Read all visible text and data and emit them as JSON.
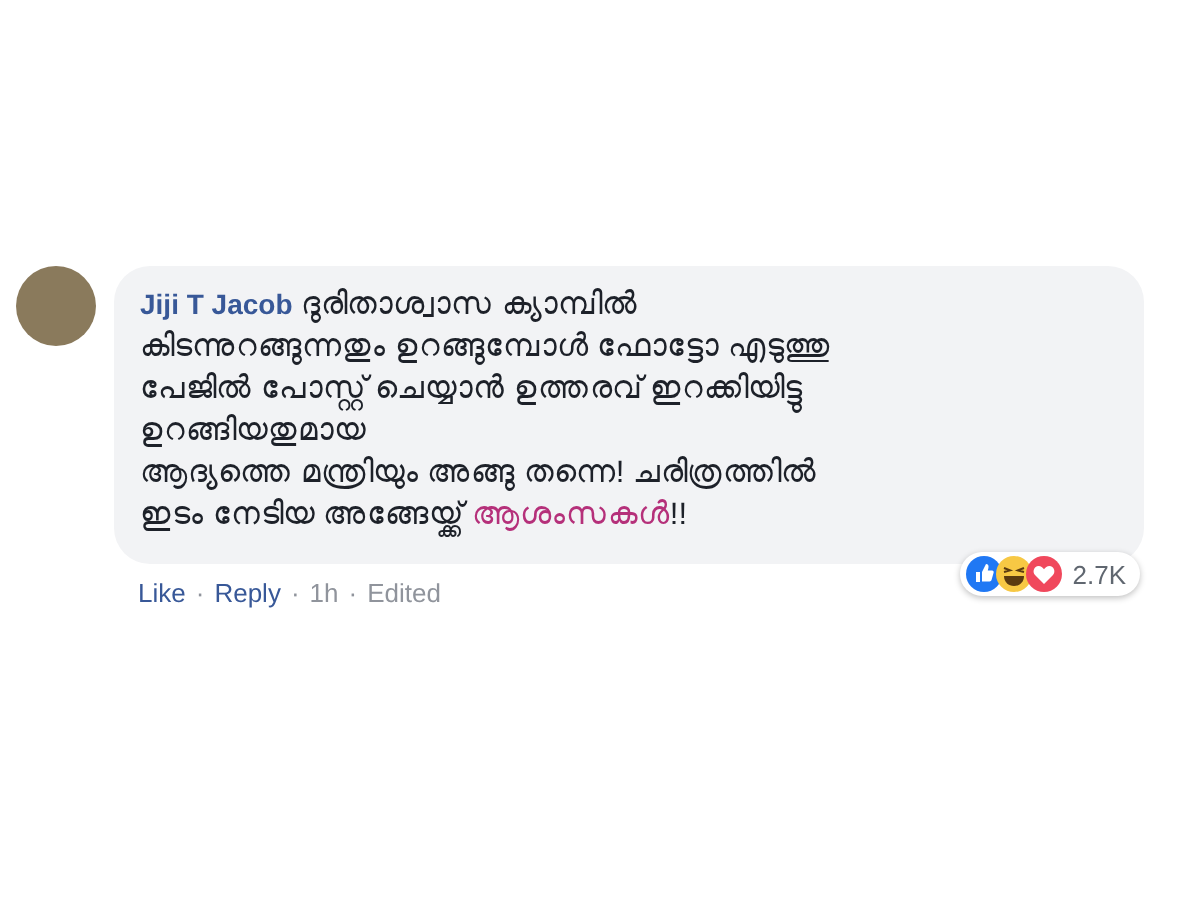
{
  "comment": {
    "author": "Jiji T Jacob",
    "body": [
      {
        "kind": "plain",
        "text": "ദുരിതാശ്വാസ ക്യാമ്പിൽ\nകിടന്നുറങ്ങുന്നതും ഉറങ്ങുമ്പോൾ ഫോട്ടോ എടുത്തു\nപേജിൽ പോസ്റ്റ് ചെയ്യാൻ ഉത്തരവ് ഇറക്കിയിട്ടു\nഉറങ്ങിയതുമായ\nആദ്യത്തെ മന്ത്രിയും അങ്ങു തന്നെ! ചരിത്രത്തിൽ\nഇടം നേടിയ അങ്ങേയ്ക്ക് "
      },
      {
        "kind": "highlight",
        "text": "ആശംസകൾ"
      },
      {
        "kind": "plain",
        "text": "!!"
      }
    ],
    "actions": [
      {
        "kind": "link",
        "text": "Like"
      },
      {
        "kind": "separator",
        "text": "·"
      },
      {
        "kind": "link",
        "text": "Reply"
      },
      {
        "kind": "separator",
        "text": "·"
      },
      {
        "kind": "time",
        "text": "1h"
      },
      {
        "kind": "separator",
        "text": "·"
      },
      {
        "kind": "note",
        "text": "Edited"
      }
    ],
    "reactions": {
      "icons": [
        {
          "kind": "like"
        },
        {
          "kind": "haha"
        },
        {
          "kind": "love"
        }
      ],
      "count": "2.7K"
    }
  }
}
